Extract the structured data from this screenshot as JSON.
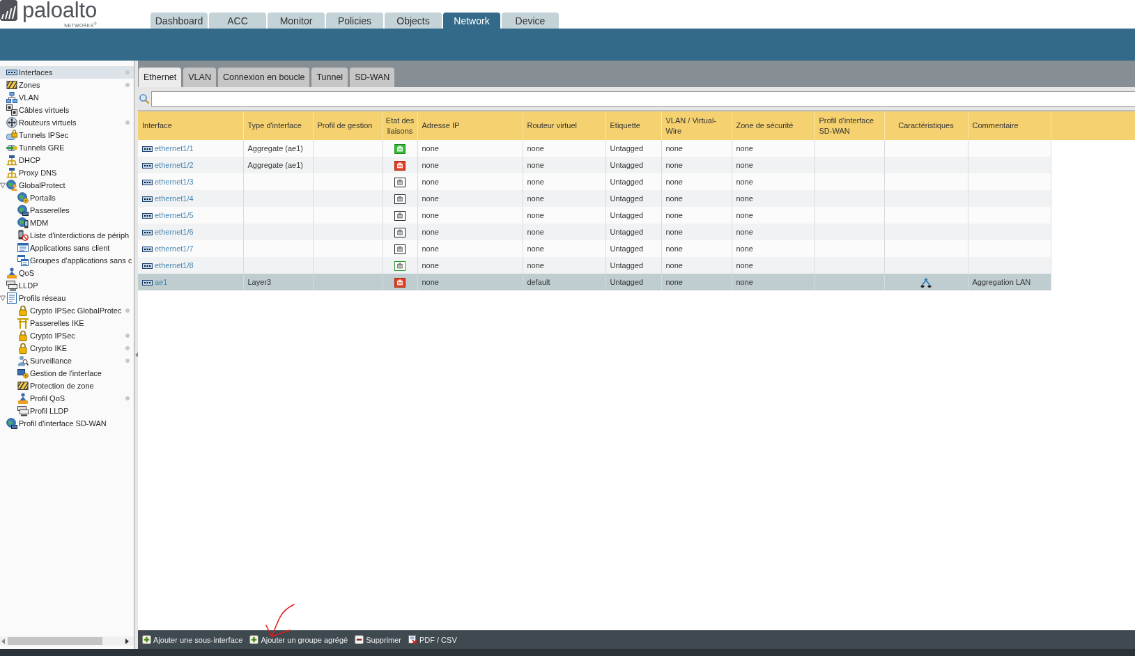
{
  "header": {
    "logo": {
      "wordmark": "paloalto",
      "tagline": "NETWORKS$^{®}$"
    },
    "tabs": [
      {
        "label": "Dashboard",
        "selected": false
      },
      {
        "label": "ACC",
        "selected": false
      },
      {
        "label": "Monitor",
        "selected": false
      },
      {
        "label": "Policies",
        "selected": false
      },
      {
        "label": "Objects",
        "selected": false
      },
      {
        "label": "Network",
        "selected": true
      },
      {
        "label": "Device",
        "selected": false
      }
    ]
  },
  "sidebar": {
    "items": [
      {
        "label": "Interfaces",
        "selected": true,
        "indicator": true
      },
      {
        "label": "Zones",
        "selected": false,
        "indicator": true
      },
      {
        "label": "VLAN",
        "selected": false,
        "indicator": false
      },
      {
        "label": "Câbles virtuels",
        "selected": false,
        "indicator": false
      },
      {
        "label": "Routeurs virtuels",
        "selected": false,
        "indicator": true
      },
      {
        "label": "Tunnels IPSec",
        "selected": false,
        "indicator": false
      },
      {
        "label": "Tunnels GRE",
        "selected": false,
        "indicator": false
      },
      {
        "label": "DHCP",
        "selected": false,
        "indicator": false
      },
      {
        "label": "Proxy DNS",
        "selected": false,
        "indicator": false
      },
      {
        "label": "GlobalProtect",
        "selected": false,
        "indicator": false,
        "expanded": true,
        "children": [
          {
            "label": "Portails",
            "selected": false,
            "indicator": false
          },
          {
            "label": "Passerelles",
            "selected": false,
            "indicator": false
          },
          {
            "label": "MDM",
            "selected": false,
            "indicator": false
          },
          {
            "label": "Liste d'interdictions de périph",
            "selected": false,
            "indicator": false
          },
          {
            "label": "Applications sans client",
            "selected": false,
            "indicator": false
          },
          {
            "label": "Groupes d'applications sans c",
            "selected": false,
            "indicator": false
          }
        ]
      },
      {
        "label": "QoS",
        "selected": false,
        "indicator": false
      },
      {
        "label": "LLDP",
        "selected": false,
        "indicator": false
      },
      {
        "label": "Profils réseau",
        "selected": false,
        "indicator": false,
        "expanded": true,
        "children": [
          {
            "label": "Crypto IPSec GlobalProtec",
            "selected": false,
            "indicator": true
          },
          {
            "label": "Passerelles IKE",
            "selected": false,
            "indicator": false
          },
          {
            "label": "Crypto IPSec",
            "selected": false,
            "indicator": true
          },
          {
            "label": "Crypto IKE",
            "selected": false,
            "indicator": true
          },
          {
            "label": "Surveillance",
            "selected": false,
            "indicator": true
          },
          {
            "label": "Gestion de l'interface",
            "selected": false,
            "indicator": false
          },
          {
            "label": "Protection de zone",
            "selected": false,
            "indicator": false
          },
          {
            "label": "Profil QoS",
            "selected": false,
            "indicator": true
          },
          {
            "label": "Profil LLDP",
            "selected": false,
            "indicator": false
          }
        ]
      },
      {
        "label": "Profil d'interface SD-WAN",
        "selected": false,
        "indicator": false
      }
    ]
  },
  "subtabs": [
    {
      "label": "Ethernet",
      "selected": true
    },
    {
      "label": "VLAN",
      "selected": false
    },
    {
      "label": "Connexion en boucle",
      "selected": false
    },
    {
      "label": "Tunnel",
      "selected": false
    },
    {
      "label": "SD-WAN",
      "selected": false
    }
  ],
  "table": {
    "columns": [
      "Interface",
      "Type d'interface",
      "Profil de gestion",
      "Etat des liaisons",
      "Adresse IP",
      "Routeur virtuel",
      "Etiquette",
      "VLAN / Virtual-Wire",
      "Zone de sécurité",
      "Profil d'interface SD-WAN",
      "Caractéristiques",
      "Commentaire"
    ],
    "rows": [
      {
        "interface": "ethernet1/1",
        "type": "Aggregate (ae1)",
        "link": {
          "kind": "up"
        },
        "ip": "none",
        "router": "none",
        "tag": "Untagged",
        "vlan": "none",
        "zone": "none",
        "feature_icon": false,
        "selected": false
      },
      {
        "interface": "ethernet1/2",
        "type": "Aggregate (ae1)",
        "link": {
          "kind": "down"
        },
        "ip": "none",
        "router": "none",
        "tag": "Untagged",
        "vlan": "none",
        "zone": "none",
        "feature_icon": false,
        "selected": false
      },
      {
        "interface": "ethernet1/3",
        "link": {
          "kind": "unknown"
        },
        "ip": "none",
        "router": "none",
        "tag": "Untagged",
        "vlan": "none",
        "zone": "none",
        "feature_icon": false,
        "selected": false
      },
      {
        "interface": "ethernet1/4",
        "link": {
          "kind": "unknown"
        },
        "ip": "none",
        "router": "none",
        "tag": "Untagged",
        "vlan": "none",
        "zone": "none",
        "feature_icon": false,
        "selected": false
      },
      {
        "interface": "ethernet1/5",
        "link": {
          "kind": "unknown"
        },
        "ip": "none",
        "router": "none",
        "tag": "Untagged",
        "vlan": "none",
        "zone": "none",
        "feature_icon": false,
        "selected": false
      },
      {
        "interface": "ethernet1/6",
        "link": {
          "kind": "unknown"
        },
        "ip": "none",
        "router": "none",
        "tag": "Untagged",
        "vlan": "none",
        "zone": "none",
        "feature_icon": false,
        "selected": false
      },
      {
        "interface": "ethernet1/7",
        "link": {
          "kind": "unknown"
        },
        "ip": "none",
        "router": "none",
        "tag": "Untagged",
        "vlan": "none",
        "zone": "none",
        "feature_icon": false,
        "selected": false
      },
      {
        "interface": "ethernet1/8",
        "link": {
          "kind": "partial"
        },
        "ip": "none",
        "router": "none",
        "tag": "Untagged",
        "vlan": "none",
        "zone": "none",
        "feature_icon": false,
        "selected": false
      },
      {
        "interface": "ae1",
        "type": "Layer3",
        "link": {
          "kind": "down"
        },
        "ip": "none",
        "router": "default",
        "tag": "Untagged",
        "vlan": "none",
        "zone": "none",
        "feature_icon": true,
        "comment": "Aggregation LAN",
        "selected": true
      }
    ]
  },
  "toolbar": {
    "buttons": [
      {
        "label": "Ajouter une sous-interface",
        "kind": "add"
      },
      {
        "label": "Ajouter un groupe agrégé",
        "kind": "add"
      },
      {
        "label": "Supprimer",
        "kind": "delete"
      },
      {
        "label": "PDF / CSV",
        "kind": "export"
      }
    ]
  }
}
